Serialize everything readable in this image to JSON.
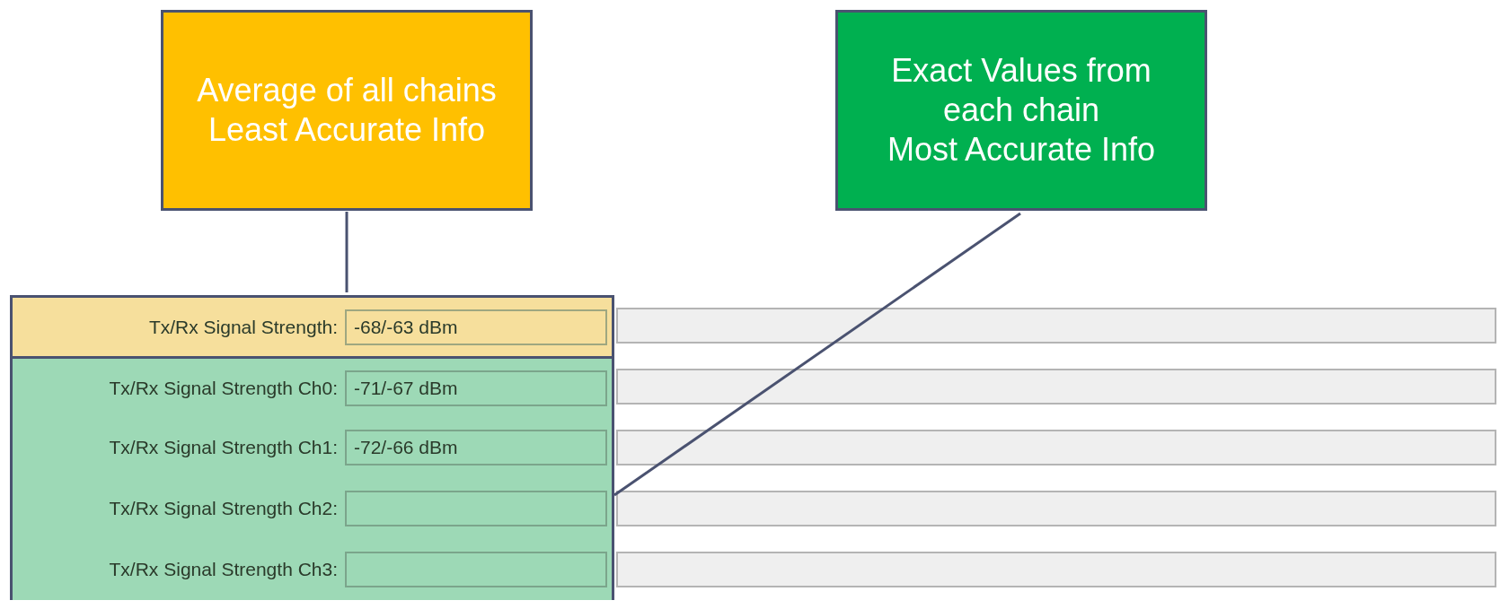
{
  "callouts": [
    {
      "kind": "average",
      "color": "#ffc000",
      "lines": [
        "Average of all chains",
        "Least Accurate Info"
      ]
    },
    {
      "kind": "chain",
      "color": "#00b050",
      "lines": [
        "Exact Values from each chain",
        "Most Accurate Info"
      ]
    }
  ],
  "rows": [
    {
      "kind": "average",
      "label": "Tx/Rx Signal Strength:",
      "value": "-68/-63 dBm"
    },
    {
      "kind": "chain",
      "label": "Tx/Rx Signal Strength Ch0:",
      "value": "-71/-67 dBm"
    },
    {
      "kind": "chain",
      "label": "Tx/Rx Signal Strength Ch1:",
      "value": "-72/-66 dBm"
    },
    {
      "kind": "chain",
      "label": "Tx/Rx Signal Strength Ch2:"
    },
    {
      "kind": "chain",
      "label": "Tx/Rx Signal Strength Ch3:"
    }
  ]
}
